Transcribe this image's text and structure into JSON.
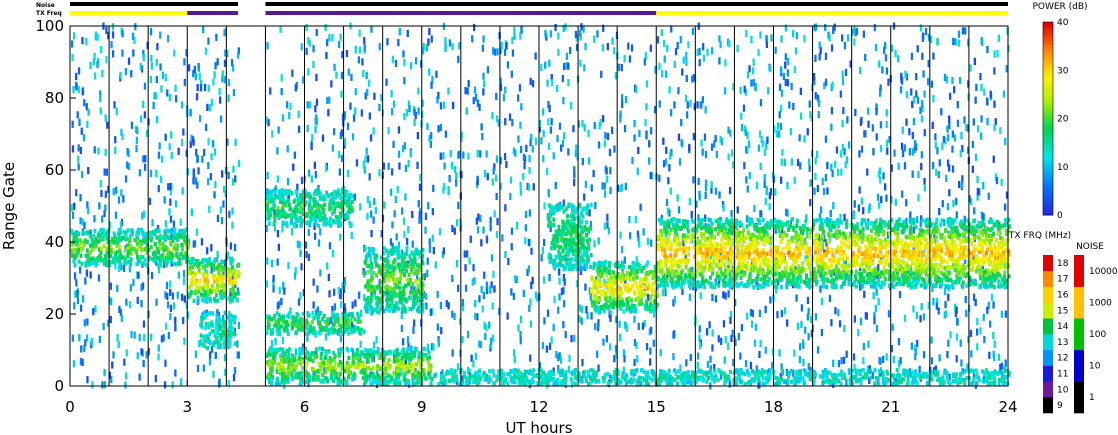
{
  "chart_data": [
    {
      "type": "heatmap",
      "title": "",
      "xlabel": "UT hours",
      "ylabel": "Range Gate",
      "xlim": [
        0,
        24
      ],
      "ylim": [
        0,
        100
      ],
      "x_ticks": [
        "0",
        "3",
        "6",
        "9",
        "12",
        "15",
        "18",
        "21",
        "24"
      ],
      "y_ticks": [
        "0",
        "20",
        "40",
        "60",
        "80",
        "100"
      ],
      "top_bar_labels": {
        "noise": "Noise",
        "txfreq": "TX Freq"
      },
      "noise_bar_segments": [
        {
          "start": 0,
          "end": 4.3,
          "color": "#000000"
        },
        {
          "start": 5,
          "end": 24,
          "color": "#000000"
        }
      ],
      "txfreq_bar_segments": [
        {
          "start": 0,
          "end": 3,
          "color": "#ffff00"
        },
        {
          "start": 3,
          "end": 4.3,
          "color": "#5a1a8c"
        },
        {
          "start": 5,
          "end": 15,
          "color": "#5a1a8c"
        },
        {
          "start": 15,
          "end": 24,
          "color": "#ffff00"
        }
      ],
      "vertical_lines": [
        1,
        2,
        3,
        4,
        5,
        6,
        7,
        8,
        9,
        10,
        11,
        12,
        13,
        14,
        15,
        16,
        17,
        18,
        19,
        20,
        21,
        22,
        23
      ],
      "data_gap": [
        4.3,
        5
      ],
      "echo_bands": [
        {
          "t0": 0,
          "t1": 3,
          "g0": 33,
          "g1": 43,
          "peak_db": 22
        },
        {
          "t0": 3,
          "t1": 4.3,
          "g0": 23,
          "g1": 35,
          "peak_db": 30
        },
        {
          "t0": 3.3,
          "t1": 4.2,
          "g0": 10,
          "g1": 20,
          "peak_db": 15
        },
        {
          "t0": 5,
          "t1": 7.2,
          "g0": 44,
          "g1": 54,
          "peak_db": 18
        },
        {
          "t0": 5,
          "t1": 7.5,
          "g0": 14,
          "g1": 20,
          "peak_db": 20
        },
        {
          "t0": 7.5,
          "t1": 9,
          "g0": 20,
          "g1": 38,
          "peak_db": 22
        },
        {
          "t0": 5,
          "t1": 9.2,
          "g0": 0,
          "g1": 10,
          "peak_db": 24
        },
        {
          "t0": 12.2,
          "t1": 13.3,
          "g0": 32,
          "g1": 50,
          "peak_db": 18
        },
        {
          "t0": 13.3,
          "t1": 15,
          "g0": 20,
          "g1": 34,
          "peak_db": 30
        },
        {
          "t0": 15,
          "t1": 24,
          "g0": 27,
          "g1": 46,
          "peak_db": 32
        },
        {
          "t0": 9.2,
          "t1": 24,
          "g0": 0,
          "g1": 4,
          "peak_db": 14
        }
      ]
    }
  ],
  "power_colorbar": {
    "title": "POWER (dB)",
    "ticks": [
      "0",
      "10",
      "20",
      "30",
      "40"
    ]
  },
  "txfreq_colorbar": {
    "title": "TX FRQ (MHz)",
    "ticks": [
      "9",
      "10",
      "11",
      "12",
      "13",
      "14",
      "15",
      "16",
      "17",
      "18"
    ]
  },
  "noise_colorbar": {
    "title": "NOISE",
    "ticks": [
      "1",
      "10",
      "100",
      "1000",
      "10000"
    ]
  }
}
